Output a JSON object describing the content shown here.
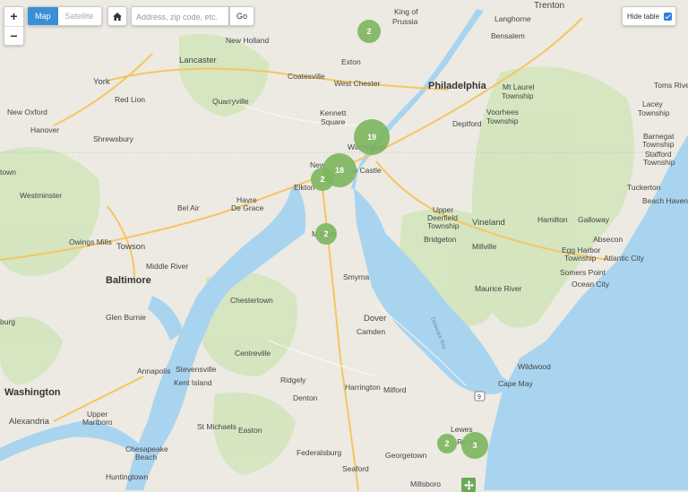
{
  "controls": {
    "zoom_in": "+",
    "zoom_out": "−",
    "map_types": [
      {
        "label": "Map",
        "active": true
      },
      {
        "label": "Satellite",
        "active": false
      }
    ],
    "home_icon": "home-icon",
    "search": {
      "placeholder": "Address, zip code, etc.",
      "value": ""
    },
    "go_label": "Go",
    "hide_table": {
      "label": "Hide table",
      "checked": true
    }
  },
  "colors": {
    "land": "#eae8e0",
    "water": "#a8d3ee",
    "park": "#cfe5b8",
    "road": "#f8c96a",
    "cluster": "#7cb65e",
    "active_tab": "#3b8fd6"
  },
  "clusters": [
    "2",
    "19",
    "18",
    "2",
    "2",
    "2",
    "3"
  ],
  "places": {
    "trenton": "Trenton",
    "langhorne": "Langhorne",
    "bensalem": "Bensalem",
    "king_of_prussia": "King of\nPrussia",
    "new_holland": "New Holland",
    "lancaster": "Lancaster",
    "exton": "Exton",
    "coatesville": "Coatesville",
    "west_chester": "West Chester",
    "philadelphia": "Philadelphia",
    "mt_laurel": "Mt Laurel\nTownship",
    "toms_river": "Toms River",
    "lacey": "Lacey\nTownship",
    "york": "York",
    "red_lion": "Red Lion",
    "quarryville": "Quarryville",
    "kennett": "Kennett\nSquare",
    "deptford": "Deptford",
    "voorhees": "Voorhees\nTownship",
    "new_oxford": "New Oxford",
    "hanover": "Hanover",
    "shrewsbury": "Shrewsbury",
    "wilmington": "Wilmington",
    "barnegat": "Barnegat\nTownship",
    "stafford": "Stafford\nTownship",
    "new_castle": "New Castle",
    "town": "town",
    "elkton": "Elkton",
    "tuckerton": "Tuckerton",
    "westminster": "Westminster",
    "havre": "Havre\nDe Grace",
    "bel_air": "Bel Air",
    "beach_haven": "Beach Haven",
    "upper_deerfield": "Upper\nDeerfield\nTownship",
    "vineland": "Vineland",
    "hamilton": "Hamilton",
    "galloway": "Galloway",
    "owings_mills": "Owings Mills",
    "towson": "Towson",
    "middletown": "Middletown",
    "bridgeton": "Bridgeton",
    "millville": "Millville",
    "absecon": "Absecon",
    "egg_harbor": "Egg Harbor\nTownship",
    "atlantic_city": "Atlantic City",
    "middle_river": "Middle River",
    "baltimore": "Baltimore",
    "smyrna": "Smyrna",
    "somers_point": "Somers Point",
    "ocean_city": "Ocean City",
    "maurice_river": "Maurice River",
    "chestertown": "Chestertown",
    "burg": "burg",
    "glen_burnie": "Glen Burnie",
    "dover": "Dover",
    "camden": "Camden",
    "centreville": "Centreville",
    "annapolis": "Annapolis",
    "stevensville": "Stevensville",
    "wildwood": "Wildwood",
    "kent_island": "Kent Island",
    "ridgely": "Ridgely",
    "harrington": "Harrington",
    "milford": "Milford",
    "cape_may": "Cape May",
    "washington": "Washington",
    "denton": "Denton",
    "alexandria": "Alexandria",
    "upper_marlboro": "Upper\nMarlboro",
    "st_michaels": "St Michaels",
    "easton": "Easton",
    "lewes": "Lewes",
    "rehoboth": "Rehoboth",
    "chesapeake_beach": "Chesapeake\nBeach",
    "federalsburg": "Federalsburg",
    "georgetown": "Georgetown",
    "huntingtown": "Huntingtown",
    "seaford": "Seaford",
    "millsboro": "Millsboro",
    "delaware_bay": "Delaware Bay",
    "route_9": "9"
  }
}
